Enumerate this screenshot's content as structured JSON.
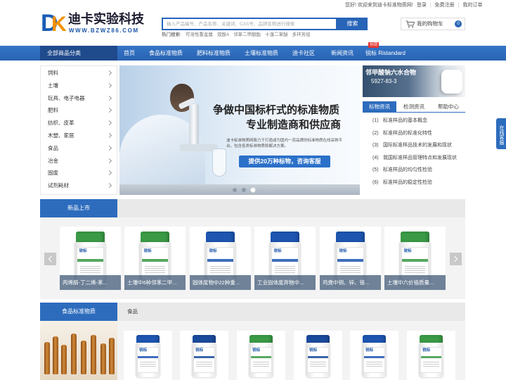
{
  "colors": {
    "accent": "#2d6cbd",
    "accent_dark": "#1f4a8c",
    "logo_blue": "#1b5db5",
    "logo_orange": "#f29100",
    "badge_red": "#e3342f",
    "lid_blue": "#1d55b0",
    "lid_green": "#3a9a45"
  },
  "topbar": {
    "welcome": "您好! 欢迎来到迪卡标准物质网!",
    "login": "登录",
    "separator": "|",
    "register": "免费注册",
    "orders": "我的订单"
  },
  "logo": {
    "mark_d": "D",
    "mark_k": "K",
    "name": "迪卡实验科技",
    "url_text": "WWW.BZWZ86.COM"
  },
  "search": {
    "placeholder": "输入产品编号、产品名称、关键词、CAS号、品牌名称进行搜索",
    "button": "搜索",
    "hot_label": "热门搜索:",
    "hot_items": [
      "可溶性重金属",
      "双酚A",
      "邻苯二甲酸酯",
      "十溴二苯醚",
      "多环芳烃"
    ]
  },
  "cart": {
    "icon": "cart-icon",
    "label": "我的购物车",
    "count": "0"
  },
  "nav": {
    "all_categories": "全部商品分类",
    "items": [
      "首页",
      "食品标准物质",
      "肥料标准物质",
      "土壤标准物质",
      "迪卡社区",
      "新闻资讯",
      "锐标 Ristandard"
    ],
    "badge": "热销"
  },
  "sidebar": {
    "chevron_icon": "chevron-right-icon",
    "items": [
      "饲料",
      "土壤",
      "玩具、电子电器",
      "肥料",
      "纺织、皮革",
      "木塑、家居",
      "食品",
      "冶金",
      "固废",
      "试剂耗材"
    ]
  },
  "banner": {
    "headline": "争做中国标杆式的标准物质",
    "subheadline": "专业制造商和供应商",
    "description": "迪卡标准物质网致力于打造成为国内一流品牌的标准物质在线采购平台，包含各类标准物质和解决方案。",
    "cta": "提供20万种标物，咨询客服",
    "slide_count": 3,
    "active_slide": 3
  },
  "promo": {
    "title": "邻甲酸钠六水合物",
    "cas": "5927-83-3"
  },
  "info_tabs": {
    "tabs": [
      "标物资讯",
      "检测资讯",
      "帮助中心"
    ],
    "active": 0,
    "news": [
      {
        "index": "(1)",
        "title": "标准样品的基本概念"
      },
      {
        "index": "(2)",
        "title": "标准样品的标准化特性"
      },
      {
        "index": "(3)",
        "title": "国际标准样品技术的发展和现状"
      },
      {
        "index": "(4)",
        "title": "我国标准样品管理特点和发展现状"
      },
      {
        "index": "(5)",
        "title": "标准样品的均匀性检验"
      },
      {
        "index": "(6)",
        "title": "标准样品的稳定性检验"
      }
    ]
  },
  "float_service": {
    "label": "在线客服"
  },
  "brand": {
    "label_text": "锐标"
  },
  "new_products": {
    "title": "新品上市",
    "prev_icon": "chevron-left-icon",
    "next_icon": "chevron-right-icon",
    "items": [
      {
        "caption": "丙烯腈-丁二烯-苯...",
        "lid_color": "#3a9a45"
      },
      {
        "caption": "土壤中6种邻苯二甲...",
        "lid_color": "#3a9a45"
      },
      {
        "caption": "固体废物中22种重...",
        "lid_color": "#1d55b0"
      },
      {
        "caption": "工业固体废弃物中...",
        "lid_color": "#1d55b0"
      },
      {
        "caption": "鸡粪中铜、锌、铬...",
        "lid_color": "#1d55b0"
      },
      {
        "caption": "土壤中六价铬质量...",
        "lid_color": "#3a9a45"
      }
    ]
  },
  "food_products": {
    "title": "食品标准物质",
    "tab": "食品",
    "items": [
      {
        "lid_color": "#1d55b0"
      },
      {
        "lid_color": "#1a4a9c"
      },
      {
        "lid_color": "#3a9a45"
      },
      {
        "lid_color": "#1a4a9c"
      },
      {
        "lid_color": "#1d55b0"
      },
      {
        "lid_color": "#3a9a45"
      }
    ]
  }
}
